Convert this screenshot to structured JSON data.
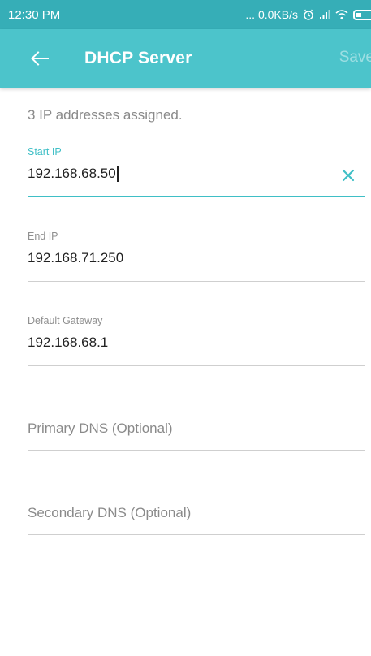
{
  "status_bar": {
    "time": "12:30 PM",
    "network_speed": "... 0.0KB/s",
    "icons": [
      "alarm-icon",
      "signal-icon",
      "wifi-icon",
      "battery-icon"
    ]
  },
  "app_bar": {
    "title": "DHCP Server",
    "save_label": "Save",
    "back_icon": "arrow-left-icon"
  },
  "summary_text": "3 IP addresses assigned.",
  "fields": {
    "start_ip": {
      "label": "Start IP",
      "value": "192.168.68.50"
    },
    "end_ip": {
      "label": "End IP",
      "value": "192.168.71.250"
    },
    "default_gateway": {
      "label": "Default Gateway",
      "value": "192.168.68.1"
    },
    "primary_dns": {
      "placeholder": "Primary DNS (Optional)",
      "value": ""
    },
    "secondary_dns": {
      "placeholder": "Secondary DNS (Optional)",
      "value": ""
    }
  },
  "colors": {
    "status_bar": "#36aeb7",
    "app_bar": "#4cc4cb",
    "accent": "#3fbfc6"
  }
}
